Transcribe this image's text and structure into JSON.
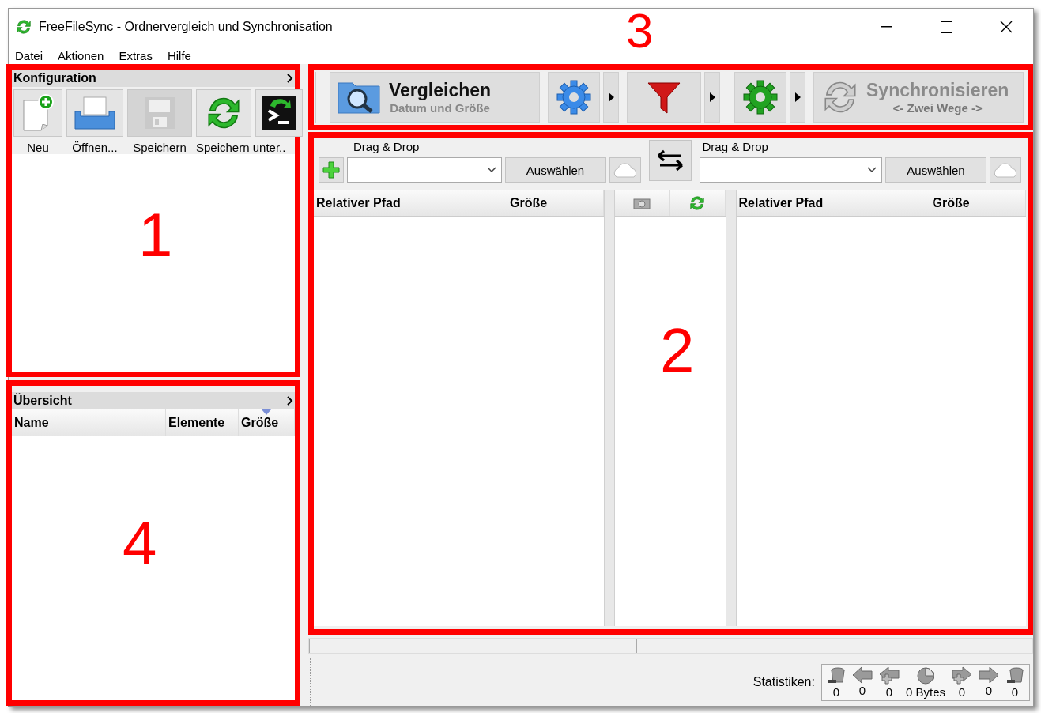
{
  "window": {
    "title": "FreeFileSync - Ordnervergleich und Synchronisation"
  },
  "menu": [
    "Datei",
    "Aktionen",
    "Extras",
    "Hilfe"
  ],
  "configuration": {
    "title": "Konfiguration",
    "annotation": "1",
    "buttons": [
      {
        "kind": "new",
        "label": "Neu",
        "disabled": false
      },
      {
        "kind": "open",
        "label": "Öffnen...",
        "disabled": false
      },
      {
        "kind": "save",
        "label": "Speichern",
        "disabled": true
      },
      {
        "kind": "save-as",
        "label": "Speichern unter..",
        "disabled": false
      },
      {
        "kind": "batch",
        "disabled": false
      }
    ]
  },
  "overview": {
    "title": "Übersicht",
    "annotation": "4",
    "columns": [
      {
        "label": "Name",
        "sorted": false
      },
      {
        "label": "Elemente",
        "sorted": false
      },
      {
        "label": "Größe",
        "sorted": true
      }
    ]
  },
  "toolbar": {
    "annotation": "3",
    "compare": {
      "title": "Vergleichen",
      "subtitle": "Datum und Größe",
      "disabled": false
    },
    "sync": {
      "title": "Synchronisieren",
      "subtitle": "<- Zwei Wege ->",
      "disabled": true
    }
  },
  "folders": {
    "annotation": "2",
    "left": {
      "label": "Drag & Drop",
      "button": "Auswählen",
      "columns": [
        "Relativer Pfad",
        "Größe"
      ]
    },
    "right": {
      "label": "Drag & Drop",
      "button": "Auswählen",
      "columns": [
        "Relativer Pfad",
        "Größe"
      ]
    }
  },
  "statistics": {
    "label": "Statistiken:",
    "items": [
      {
        "kind": "delete-left",
        "value": "0"
      },
      {
        "kind": "update-left",
        "value": "0"
      },
      {
        "kind": "create-left",
        "value": "0"
      },
      {
        "kind": "data",
        "value": "0 Bytes"
      },
      {
        "kind": "create-right",
        "value": "0"
      },
      {
        "kind": "update-right",
        "value": "0"
      },
      {
        "kind": "delete-right",
        "value": "0"
      }
    ]
  }
}
